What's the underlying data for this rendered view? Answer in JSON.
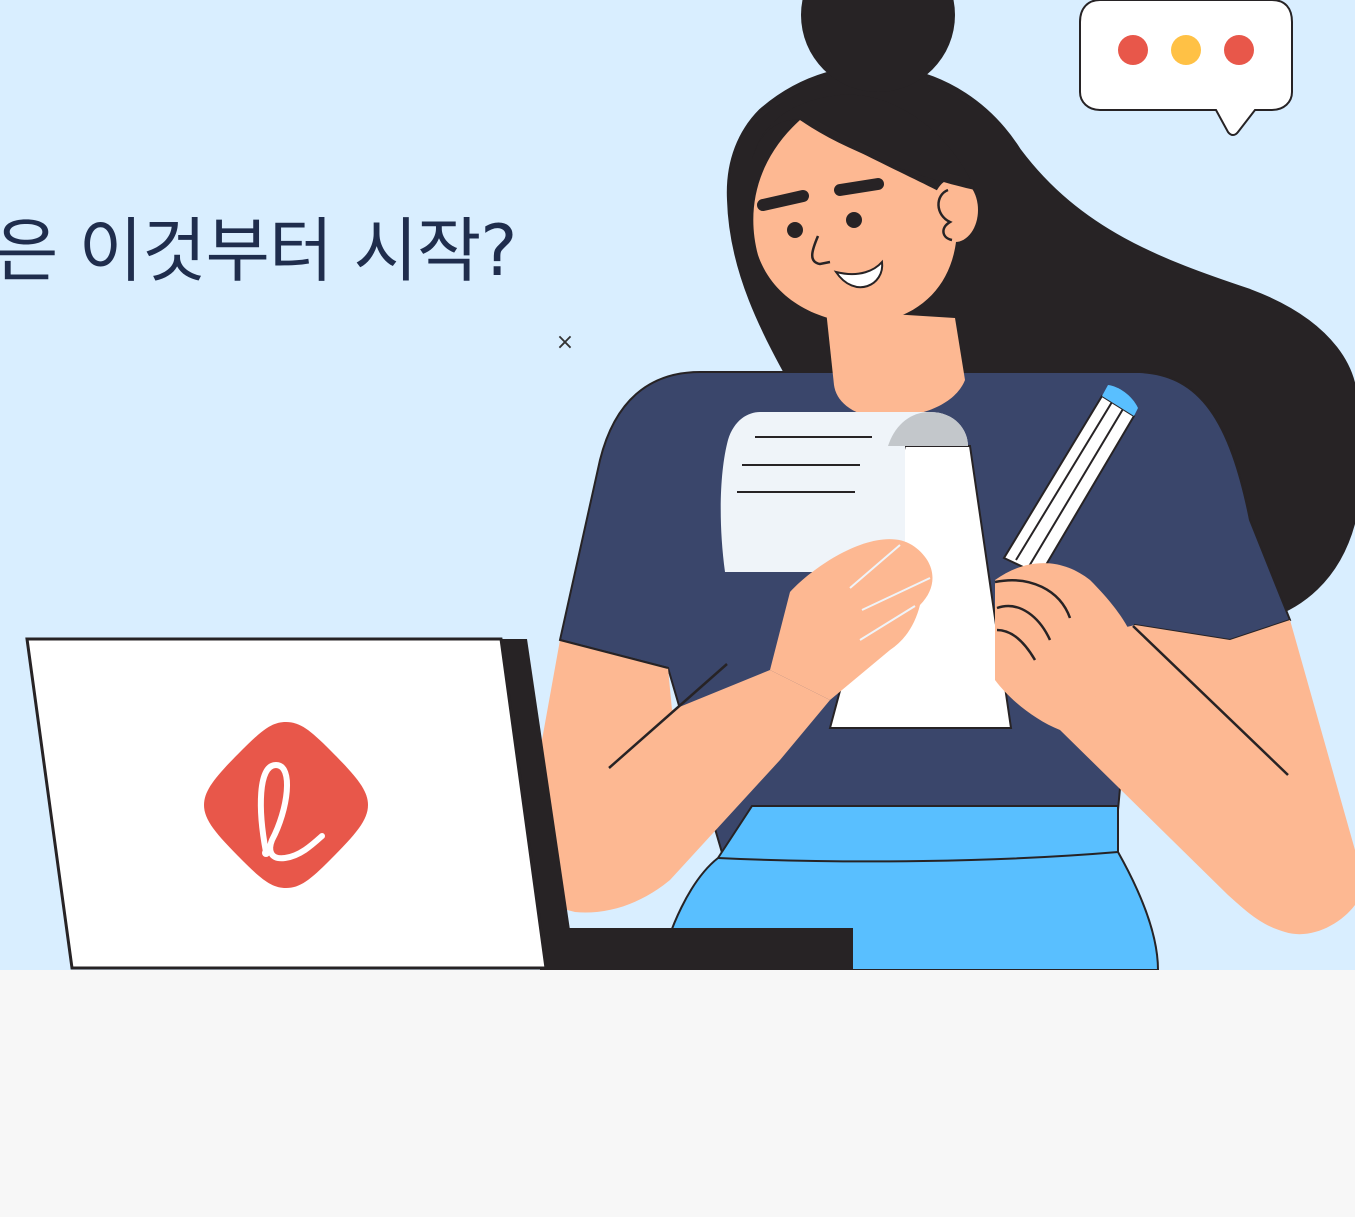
{
  "banner": {
    "headline": "은 이것부터 시작?",
    "close_symbol": "×"
  },
  "illustration": {
    "logo_icon": "lotte-l-icon",
    "speech_bubble_icon": "typing-dots-icon"
  },
  "colors": {
    "background": "#d9eeff",
    "footer": "#f7f7f7",
    "headline": "#1f2d4d",
    "brand_red": "#e8574a",
    "dot_yellow": "#ffc145",
    "shirt": "#3a466b",
    "skirt": "#59bfff",
    "skin": "#fdb892",
    "hair": "#272325"
  }
}
